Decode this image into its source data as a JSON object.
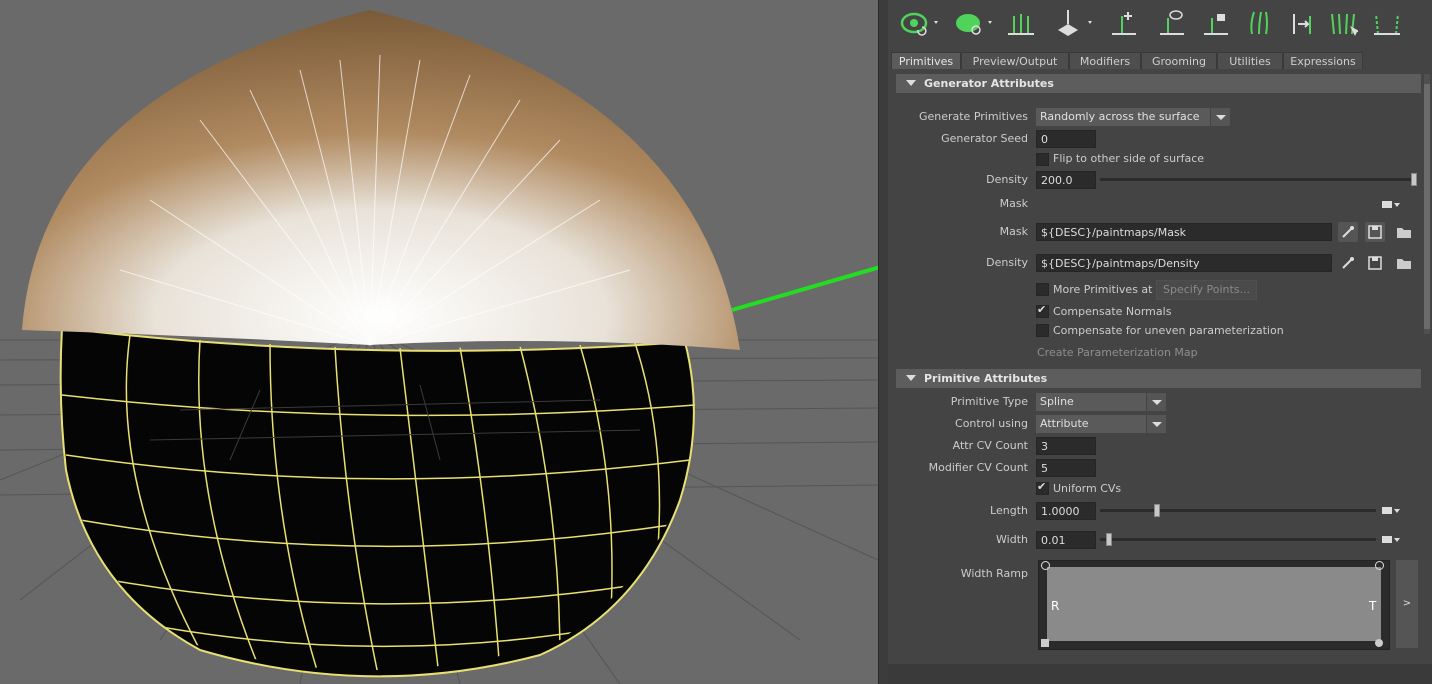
{
  "tabs": [
    {
      "label": "Primitives"
    },
    {
      "label": "Preview/Output"
    },
    {
      "label": "Modifiers"
    },
    {
      "label": "Grooming"
    },
    {
      "label": "Utilities"
    },
    {
      "label": "Expressions"
    }
  ],
  "generator": {
    "title": "Generator Attributes",
    "generate_primitives_label": "Generate Primitives",
    "generate_primitives_value": "Randomly across the surface",
    "seed_label": "Generator Seed",
    "seed_value": "0",
    "flip_label": "Flip to other side of surface",
    "density_label": "Density",
    "density_value": "200.0",
    "mask_label": "Mask",
    "mask_map_label": "Mask",
    "mask_map_value": "${DESC}/paintmaps/Mask",
    "density_map_label": "Density",
    "density_map_value": "${DESC}/paintmaps/Density",
    "more_primitives_label": "More Primitives at",
    "specify_points_label": "Specify Points...",
    "compensate_normals_label": "Compensate Normals",
    "compensate_param_label": "Compensate for uneven parameterization",
    "create_param_map_label": "Create Parameterization Map"
  },
  "primitive": {
    "title": "Primitive Attributes",
    "type_label": "Primitive Type",
    "type_value": "Spline",
    "control_label": "Control using",
    "control_value": "Attribute",
    "attr_cv_label": "Attr CV Count",
    "attr_cv_value": "3",
    "mod_cv_label": "Modifier CV Count",
    "mod_cv_value": "5",
    "uniform_cvs_label": "Uniform CVs",
    "length_label": "Length",
    "length_value": "1.0000",
    "width_label": "Width",
    "width_value": "0.01",
    "width_ramp_label": "Width Ramp",
    "ramp_left": "R",
    "ramp_right": "T",
    "ramp_expand": ">"
  },
  "colors": {
    "arrow": "#22dd22",
    "wire": "#e8e070",
    "hair_brown": "#8a6a45"
  }
}
